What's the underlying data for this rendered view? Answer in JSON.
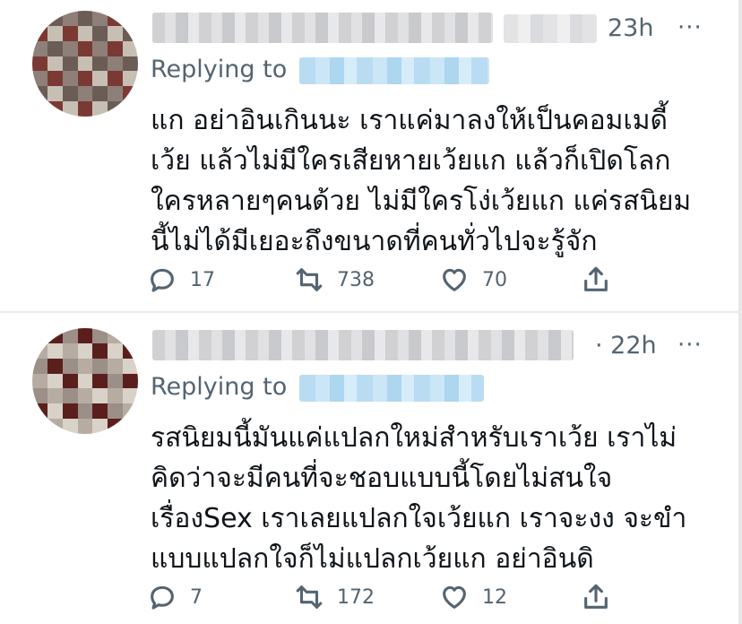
{
  "tweets": [
    {
      "time": "23h",
      "replying_label": "Replying to",
      "body_lines": [
        "แก อย่าอินเกินนะ เราแค่มาลงให้เป็นคอมเมดี้",
        "เว้ย แล้วไม่มีใครเสียหายเว้ยแก แล้วก็เปิดโลก",
        "ใครหลายๆคนด้วย ไม่มีใครโง่เว้ยแก แค่รสนิยม",
        "นี้ไม่ได้มีเยอะถึงขนาดที่คนทั่วไปจะรู้จัก"
      ],
      "replies": "17",
      "retweets": "738",
      "likes": "70"
    },
    {
      "time": "· 22h",
      "replying_label": "Replying to",
      "body_lines": [
        "รสนิยมนี้มันแค่แปลกใหม่สำหรับเราเว้ย เราไม่",
        "คิดว่าจะมีคนที่จะชอบแบบนี้โดยไม่สนใจ",
        "เรื่องSex เราเลยแปลกใจเว้ยแก เราจะงง จะขำ",
        "แบบแปลกใจก็ไม่แปลกเว้ยแก อย่าอินดิ"
      ],
      "replies": "7",
      "retweets": "172",
      "likes": "12"
    }
  ],
  "more_glyph": "···",
  "icons": {
    "reply": "reply-icon",
    "retweet": "retweet-icon",
    "like": "heart-icon",
    "share": "share-icon"
  },
  "colors": {
    "secondary_text": "#536471",
    "link_blur": "#b9dcf2"
  }
}
